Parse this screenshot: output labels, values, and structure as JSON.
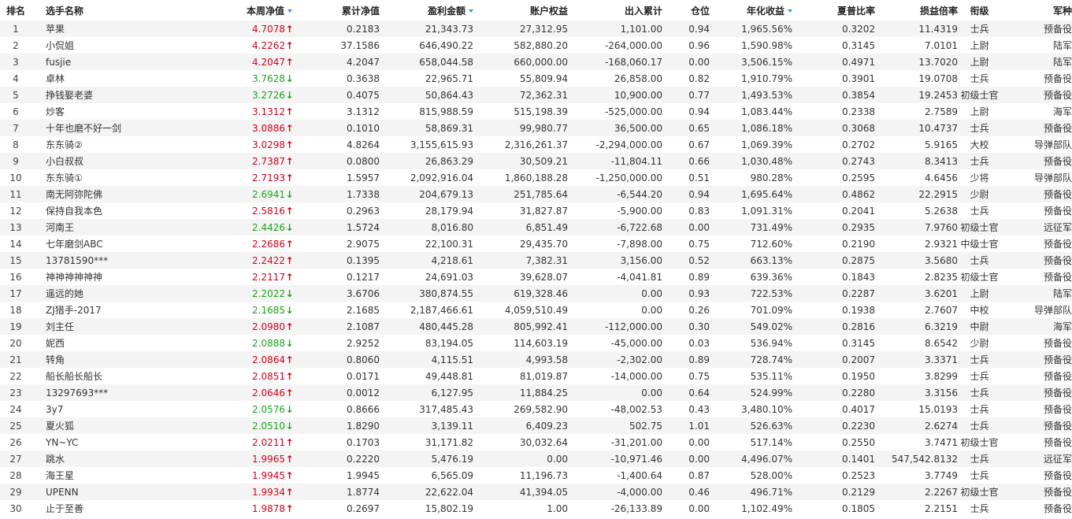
{
  "headers": [
    {
      "label": "排名",
      "sort": false
    },
    {
      "label": "选手名称",
      "sort": false
    },
    {
      "label": "本周净值",
      "sort": true
    },
    {
      "label": "累计净值",
      "sort": false
    },
    {
      "label": "盈利金额",
      "sort": true
    },
    {
      "label": "账户权益",
      "sort": false
    },
    {
      "label": "出入累计",
      "sort": false
    },
    {
      "label": "仓位",
      "sort": false
    },
    {
      "label": "年化收益",
      "sort": true
    },
    {
      "label": "夏普比率",
      "sort": false
    },
    {
      "label": "损益倍率",
      "sort": false
    },
    {
      "label": "衔级",
      "sort": false
    },
    {
      "label": "军种",
      "sort": false
    }
  ],
  "colors": {
    "up": "#d0021b",
    "down": "#1aa31a",
    "sort_icon": "#3a8ee6"
  },
  "icons": {
    "up": "arrow-up-icon",
    "down": "arrow-down-icon",
    "sort": "sort-desc-icon"
  },
  "rows": [
    [
      "1",
      "苹果",
      "4.7078",
      "up",
      "0.2183",
      "21,343.73",
      "27,312.95",
      "1,101.00",
      "0.94",
      "1,965.56%",
      "0.3202",
      "11.4319",
      "士兵",
      "预备役"
    ],
    [
      "2",
      "小侃姐",
      "4.2262",
      "up",
      "37.1586",
      "646,490.22",
      "582,880.20",
      "-264,000.00",
      "0.96",
      "1,590.98%",
      "0.3145",
      "7.0101",
      "上尉",
      "陆军"
    ],
    [
      "3",
      "fusjie",
      "4.2047",
      "up",
      "4.2047",
      "658,044.58",
      "660,000.00",
      "-168,060.17",
      "0.00",
      "3,506.15%",
      "0.4971",
      "13.7020",
      "上尉",
      "陆军"
    ],
    [
      "4",
      "卓林",
      "3.7628",
      "down",
      "0.3638",
      "22,965.71",
      "55,809.94",
      "26,858.00",
      "0.82",
      "1,910.79%",
      "0.3901",
      "19.0708",
      "士兵",
      "预备役"
    ],
    [
      "5",
      "挣钱娶老婆",
      "3.2726",
      "down",
      "0.4075",
      "50,864.43",
      "72,362.31",
      "10,900.00",
      "0.77",
      "1,493.53%",
      "0.3854",
      "19.2453",
      "初级士官",
      "预备役"
    ],
    [
      "6",
      "炒客",
      "3.1312",
      "up",
      "3.1312",
      "815,988.59",
      "515,198.39",
      "-525,000.00",
      "0.94",
      "1,083.44%",
      "0.2338",
      "2.7589",
      "上尉",
      "海军"
    ],
    [
      "7",
      "十年也磨不好一剑",
      "3.0886",
      "up",
      "0.1010",
      "58,869.31",
      "99,980.77",
      "36,500.00",
      "0.65",
      "1,086.18%",
      "0.3068",
      "10.4737",
      "士兵",
      "预备役"
    ],
    [
      "8",
      "东东骑②",
      "3.0298",
      "up",
      "4.8264",
      "3,155,615.93",
      "2,316,261.37",
      "-2,294,000.00",
      "0.67",
      "1,069.39%",
      "0.2702",
      "5.9165",
      "大校",
      "导弹部队"
    ],
    [
      "9",
      "小白叔叔",
      "2.7387",
      "up",
      "0.0800",
      "26,863.29",
      "30,509.21",
      "-11,804.11",
      "0.66",
      "1,030.48%",
      "0.2743",
      "8.3413",
      "士兵",
      "预备役"
    ],
    [
      "10",
      "东东骑①",
      "2.7193",
      "up",
      "1.5957",
      "2,092,916.04",
      "1,860,188.28",
      "-1,250,000.00",
      "0.51",
      "980.28%",
      "0.2595",
      "4.6456",
      "少将",
      "导弹部队"
    ],
    [
      "11",
      "南无阿弥陀佛",
      "2.6941",
      "down",
      "1.7338",
      "204,679.13",
      "251,785.64",
      "-6,544.20",
      "0.94",
      "1,695.64%",
      "0.4862",
      "22.2915",
      "少尉",
      "预备役"
    ],
    [
      "12",
      "保持自我本色",
      "2.5816",
      "up",
      "0.2963",
      "28,179.94",
      "31,827.87",
      "-5,900.00",
      "0.83",
      "1,091.31%",
      "0.2041",
      "5.2638",
      "士兵",
      "预备役"
    ],
    [
      "13",
      "河南王",
      "2.4426",
      "down",
      "1.5724",
      "8,016.80",
      "6,851.49",
      "-6,722.68",
      "0.00",
      "731.49%",
      "0.2935",
      "7.9760",
      "初级士官",
      "远征军"
    ],
    [
      "14",
      "七年磨剑ABC",
      "2.2686",
      "up",
      "2.9075",
      "22,100.31",
      "29,435.70",
      "-7,898.00",
      "0.75",
      "712.60%",
      "0.2190",
      "2.9321",
      "中级士官",
      "预备役"
    ],
    [
      "15",
      "13781590***",
      "2.2422",
      "up",
      "0.1395",
      "4,218.61",
      "7,382.31",
      "3,156.00",
      "0.52",
      "663.13%",
      "0.2875",
      "3.5680",
      "士兵",
      "预备役"
    ],
    [
      "16",
      "神神神神神神",
      "2.2117",
      "up",
      "0.1217",
      "24,691.03",
      "39,628.07",
      "-4,041.81",
      "0.89",
      "639.36%",
      "0.1843",
      "2.8235",
      "初级士官",
      "预备役"
    ],
    [
      "17",
      "遥远的她",
      "2.2022",
      "down",
      "3.6706",
      "380,874.55",
      "619,328.46",
      "0.00",
      "0.93",
      "722.53%",
      "0.2287",
      "3.6201",
      "上尉",
      "陆军"
    ],
    [
      "18",
      "ZJ猎手-2017",
      "2.1685",
      "down",
      "2.1685",
      "2,187,466.61",
      "4,059,510.49",
      "0.00",
      "0.26",
      "701.09%",
      "0.1938",
      "2.7607",
      "中校",
      "导弹部队"
    ],
    [
      "19",
      "刘主任",
      "2.0980",
      "up",
      "2.1087",
      "480,445.28",
      "805,992.41",
      "-112,000.00",
      "0.30",
      "549.02%",
      "0.2816",
      "6.3219",
      "中尉",
      "海军"
    ],
    [
      "20",
      "妮西",
      "2.0888",
      "down",
      "2.9252",
      "83,194.05",
      "114,603.19",
      "-45,000.00",
      "0.03",
      "536.94%",
      "0.3145",
      "8.6542",
      "少尉",
      "预备役"
    ],
    [
      "21",
      "转角",
      "2.0864",
      "up",
      "0.8060",
      "4,115.51",
      "4,993.58",
      "-2,302.00",
      "0.89",
      "728.74%",
      "0.2007",
      "3.3371",
      "士兵",
      "预备役"
    ],
    [
      "22",
      "船长船长船长",
      "2.0851",
      "up",
      "0.0171",
      "49,448.81",
      "81,019.87",
      "-14,000.00",
      "0.75",
      "535.11%",
      "0.1950",
      "3.8299",
      "士兵",
      "预备役"
    ],
    [
      "23",
      "13297693***",
      "2.0646",
      "up",
      "0.0012",
      "6,127.95",
      "11,884.25",
      "0.00",
      "0.64",
      "524.99%",
      "0.2280",
      "3.3156",
      "士兵",
      "预备役"
    ],
    [
      "24",
      "3y7",
      "2.0576",
      "down",
      "0.8666",
      "317,485.43",
      "269,582.90",
      "-48,002.53",
      "0.43",
      "3,480.10%",
      "0.4017",
      "15.0193",
      "士兵",
      "预备役"
    ],
    [
      "25",
      "夏火狐",
      "2.0510",
      "down",
      "1.8290",
      "3,139.11",
      "6,409.23",
      "502.75",
      "1.01",
      "526.63%",
      "0.2230",
      "2.6274",
      "士兵",
      "预备役"
    ],
    [
      "26",
      "YN~YC",
      "2.0211",
      "up",
      "0.1703",
      "31,171.82",
      "30,032.64",
      "-31,201.00",
      "0.00",
      "517.14%",
      "0.2550",
      "3.7471",
      "初级士官",
      "预备役"
    ],
    [
      "27",
      "跳水",
      "1.9965",
      "up",
      "0.2220",
      "5,476.19",
      "0.00",
      "-10,971.46",
      "0.00",
      "4,496.07%",
      "0.1401",
      "547,542.8132",
      "士兵",
      "远征军"
    ],
    [
      "28",
      "海王星",
      "1.9945",
      "up",
      "1.9945",
      "6,565.09",
      "11,196.73",
      "-1,400.64",
      "0.87",
      "528.00%",
      "0.2523",
      "3.7749",
      "士兵",
      "预备役"
    ],
    [
      "29",
      "UPENN",
      "1.9934",
      "up",
      "1.8774",
      "22,622.04",
      "41,394.05",
      "-4,000.00",
      "0.46",
      "496.71%",
      "0.2129",
      "2.2267",
      "初级士官",
      "预备役"
    ],
    [
      "30",
      "止于至善",
      "1.9878",
      "up",
      "0.2697",
      "15,802.19",
      "1.00",
      "-26,133.89",
      "0.00",
      "1,102.49%",
      "0.1805",
      "2.2151",
      "士兵",
      "预备役"
    ]
  ]
}
